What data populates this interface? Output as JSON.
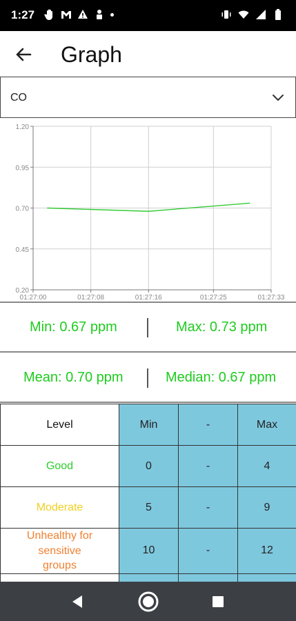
{
  "status_bar": {
    "time": "1:27",
    "left_icons": [
      "hand-icon",
      "gmail-icon",
      "warning-icon",
      "person-icon",
      "dot-icon"
    ],
    "right_icons": [
      "vibrate-icon",
      "wifi-icon",
      "signal-icon",
      "battery-icon"
    ]
  },
  "app_bar": {
    "title": "Graph"
  },
  "gas_select": {
    "value": "CO"
  },
  "chart_data": {
    "type": "line",
    "title": "",
    "xlabel": "",
    "ylabel": "",
    "ylim": [
      0.2,
      1.2
    ],
    "y_ticks": [
      "0.20",
      "0.45",
      "0.70",
      "0.95",
      "1.20"
    ],
    "x_ticks": [
      "01:27:00",
      "01:27:08",
      "01:27:16",
      "01:27:25",
      "01:27:33"
    ],
    "grid": true,
    "series": [
      {
        "color": "#33cc33",
        "points": [
          {
            "x": "01:27:02",
            "y": 0.7
          },
          {
            "x": "01:27:16",
            "y": 0.68
          },
          {
            "x": "01:27:30",
            "y": 0.73
          }
        ]
      }
    ]
  },
  "stats": {
    "min": "Min: 0.67 ppm",
    "max": "Max: 0.73 ppm",
    "mean": "Mean: 0.70 ppm",
    "median": "Median: 0.67 ppm",
    "color": "#1ecb1e"
  },
  "aq_table": {
    "header": {
      "level": "Level",
      "min": "Min",
      "dash": "-",
      "max": "Max"
    },
    "rows": [
      {
        "level": "Good",
        "color": "#2ecc2e",
        "min": "0",
        "dash": "-",
        "max": "4"
      },
      {
        "level": "Moderate",
        "color": "#f0d020",
        "min": "5",
        "dash": "-",
        "max": "9"
      },
      {
        "level": "Unhealthy for sensitive groups",
        "color": "#f08030",
        "min": "10",
        "dash": "-",
        "max": "12"
      }
    ]
  },
  "nav_bar": {
    "buttons": [
      "back-nav-icon",
      "home-nav-icon",
      "recents-nav-icon"
    ]
  },
  "colors": {
    "accent_teal": "#7ec8de",
    "status_bar": "#000000",
    "nav_bar": "#3c4044"
  }
}
